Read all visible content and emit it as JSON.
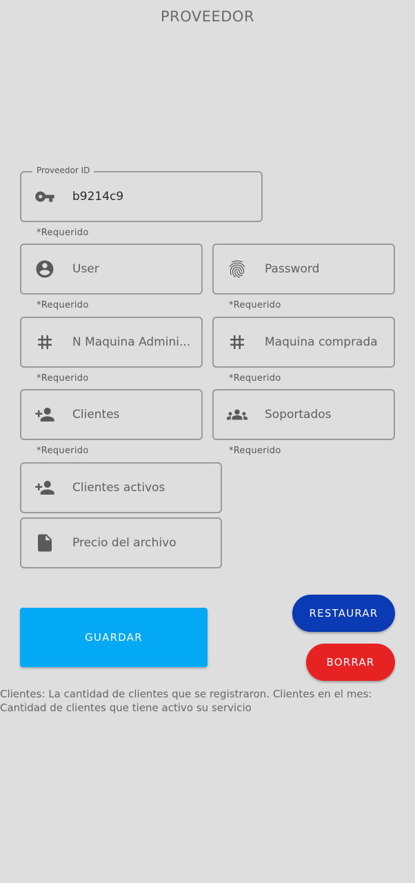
{
  "header": {
    "title": "PROVEEDOR"
  },
  "form": {
    "proveedor_id": {
      "label": "Proveedor ID",
      "value": "b9214c9",
      "icon": "key-icon",
      "hint": "*Requerido"
    },
    "user": {
      "placeholder": "User",
      "icon": "account-circle-icon",
      "hint": "*Requerido"
    },
    "password": {
      "placeholder": "Password",
      "icon": "fingerprint-icon",
      "hint": "*Requerido"
    },
    "n_maquina_admin": {
      "placeholder": "N Maquina Admini...",
      "icon": "hash-icon",
      "hint": "*Requerido"
    },
    "maquina_comprada": {
      "placeholder": "Maquina comprada",
      "icon": "hash-icon",
      "hint": "*Requerido"
    },
    "clientes": {
      "placeholder": "Clientes",
      "icon": "person-add-icon",
      "hint": "*Requerido"
    },
    "soportados": {
      "placeholder": "Soportados",
      "icon": "group-icon",
      "hint": "*Requerido"
    },
    "clientes_activos": {
      "placeholder": "Clientes activos",
      "icon": "person-add-icon"
    },
    "precio_archivo": {
      "placeholder": "Precio del archivo",
      "icon": "file-icon"
    }
  },
  "buttons": {
    "save": "GUARDAR",
    "restore": "RESTAURAR",
    "delete": "BORRAR"
  },
  "help_text": "Clientes: La cantidad de clientes que se registraron. Clientes en el mes: Cantidad de clientes que tiene activo su servicio",
  "colors": {
    "background": "#dedede",
    "save": "#03a9f4",
    "restore": "#0a3bb5",
    "delete": "#e62222"
  }
}
